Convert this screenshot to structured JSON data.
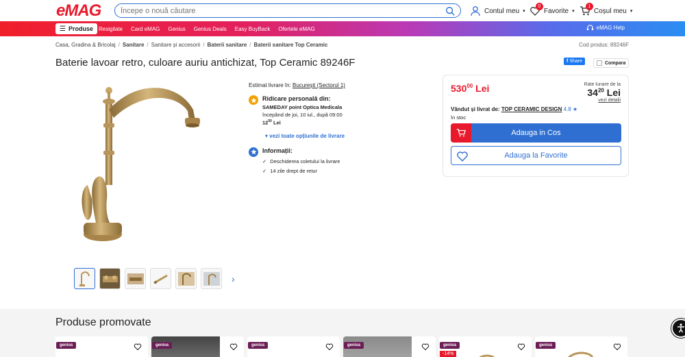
{
  "header": {
    "logo": "eMAG",
    "search_placeholder": "Începe o nouă căutare",
    "account": "Contul meu",
    "favorites": "Favorite",
    "favorites_count": "0",
    "cart": "Coșul meu",
    "cart_count": "1"
  },
  "nav": {
    "produse": "Produse",
    "links": [
      "Resigilate",
      "Card eMAG",
      "Genius",
      "Genius Deals",
      "Easy BuyBack",
      "Ofertele eMAG"
    ],
    "help": "eMAG Help"
  },
  "breadcrumb": [
    "Casa, Gradina & Bricolaj",
    "Sanitare",
    "Sanitare și accesorii",
    "Baterii sanitare",
    "Baterii sanitare Top Ceramic"
  ],
  "product_code": "Cod produs: 89246F",
  "title": "Baterie lavoar retro, culoare auriu antichizat, Top Ceramic 89246F",
  "share": "Share",
  "compare": "Compara",
  "delivery": {
    "estim_label": "Estimat livrare în:",
    "estim_location": "București (Sectorul 1)",
    "pickup_title": "Ridicare personală din:",
    "pickup_place": "SAMEDAY point Optica Medicala",
    "pickup_time": "începând de joi, 10 iul., după 09:00",
    "pickup_price_main": "12",
    "pickup_price_dec": "50",
    "pickup_currency": "Lei",
    "options_link": "vezi toate opțiunile de livrare",
    "info_title": "Informații:",
    "info_items": [
      "Deschiderea coletului la livrare",
      "14 zile drept de retur"
    ]
  },
  "pricebox": {
    "price_main": "530",
    "price_dec": "00",
    "currency": "Lei",
    "rate_label": "Rate lunare de la",
    "rate_main": "34",
    "rate_dec": "20",
    "rate_currency": "Lei",
    "rate_link": "vezi detalii",
    "seller_label": "Vândut și livrat de:",
    "seller_name": "TOP CERAMIC DESIGN",
    "seller_rating": "4.8",
    "stock": "în stoc",
    "add_cart": "Adauga in Cos",
    "add_fav": "Adauga la Favorite"
  },
  "promo": {
    "title": "Produse promovate",
    "cards": [
      {
        "badge": "genius",
        "discount": ""
      },
      {
        "badge": "genius",
        "discount": ""
      },
      {
        "badge": "genius",
        "discount": ""
      },
      {
        "badge": "genius",
        "discount": ""
      },
      {
        "badge": "genius",
        "discount": "-14%"
      },
      {
        "badge": "genius",
        "discount": ""
      }
    ]
  },
  "colors": {
    "brand_red": "#e8192c",
    "brand_blue": "#2f6fd1",
    "brass": "#b8955a"
  }
}
